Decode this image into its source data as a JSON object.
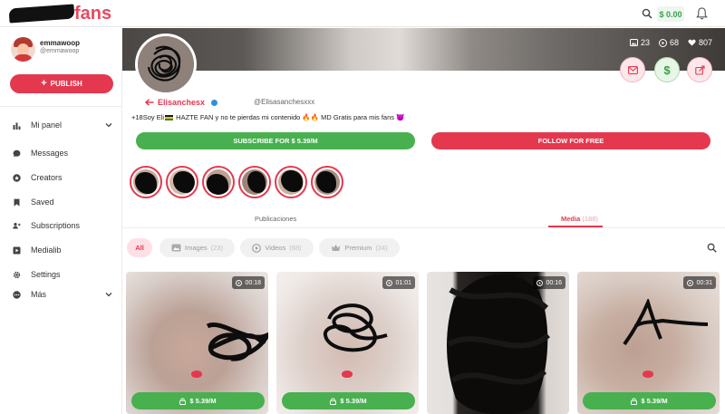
{
  "topbar": {
    "logo_text": "fans",
    "balance": "$ 0.00"
  },
  "sidebar": {
    "user": {
      "name": "emmawoop",
      "handle": "@emmawoop"
    },
    "publish_label": "PUBLISH",
    "items": [
      {
        "label": "Mi panel",
        "icon": "bar-chart-icon",
        "chevron": true
      },
      {
        "label": "Messages",
        "icon": "chat-icon"
      },
      {
        "label": "Creators",
        "icon": "star-icon"
      },
      {
        "label": "Saved",
        "icon": "bookmark-icon"
      },
      {
        "label": "Subscriptions",
        "icon": "users-icon"
      },
      {
        "label": "Medialib",
        "icon": "play-square-icon"
      },
      {
        "label": "Settings",
        "icon": "gear-icon"
      },
      {
        "label": "Más",
        "icon": "more-dots-icon",
        "chevron": true
      }
    ]
  },
  "profile": {
    "stats": {
      "images": "23",
      "videos": "68",
      "likes": "807"
    },
    "display_name": "Elisanchesx",
    "handle": "@Elisasanchesxxx",
    "bio_parts": [
      "+18Soy Eli",
      " HAZTE FAN y no te pierdas mi contenido ",
      "🔥🔥",
      " MD Gratis para mis fans "
    ],
    "subscribe_label": "SUBSCRIBE FOR  $ 5.39/M",
    "follow_label": "FOLLOW FOR FREE"
  },
  "tabs": {
    "publicaciones": "Publicaciones",
    "media": "Media",
    "media_count": "(188)"
  },
  "filters": {
    "all": "All",
    "images": "Images",
    "images_count": "(23)",
    "videos": "Videos",
    "videos_count": "(68)",
    "premium": "Premium",
    "premium_count": "(24)"
  },
  "media": [
    {
      "duration": "00:18",
      "price": "$ 5.39/M"
    },
    {
      "duration": "01:01",
      "price": "$ 5.39/M"
    },
    {
      "duration": "00:16",
      "price": ""
    },
    {
      "duration": "00:31",
      "price": "$ 5.39/M"
    }
  ],
  "colors": {
    "brand": "#e4384f",
    "green": "#48b04f"
  }
}
